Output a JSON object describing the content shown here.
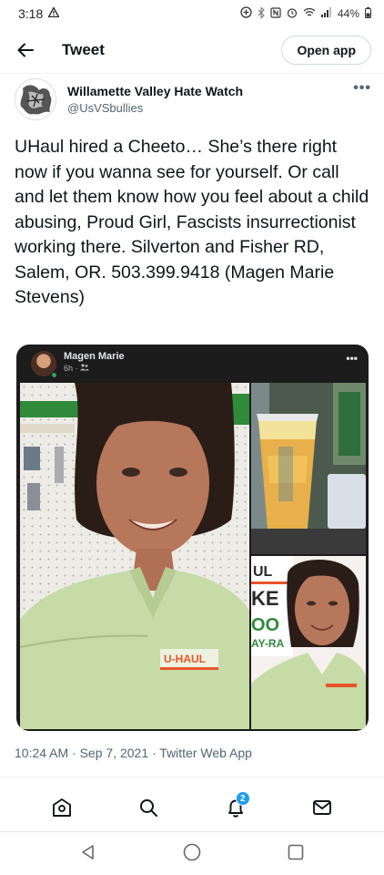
{
  "status_bar": {
    "time": "3:18",
    "battery": "44%",
    "icons": [
      "alert-icon",
      "add-circle-icon",
      "bluetooth-icon",
      "nfc-icon",
      "alarm-icon",
      "wifi-icon",
      "signal-icon",
      "battery-icon"
    ]
  },
  "header": {
    "back_icon": "back-arrow-icon",
    "title": "Tweet",
    "open_app_label": "Open app"
  },
  "tweet": {
    "author_name": "Willamette Valley Hate Watch",
    "author_handle": "@UsVSbullies",
    "more_icon": "more-icon",
    "text": "UHaul hired a Cheeto… She’s there right now if you wanna see for yourself. Or call and let them know how you feel about a child abusing, Proud Girl, Fascists insurrectionist working there. Silverton and Fisher RD, Salem, OR. 503.399.9418 (Magen Marie Stevens)",
    "timestamp": "10:24 AM · Sep 7, 2021 · Twitter Web App"
  },
  "embedded_post": {
    "name": "Magen Marie",
    "time": "6h",
    "main_photo_sign": "U-HAUL",
    "bottom_photo_sign_lines": [
      "UL",
      "KE",
      "OO",
      "AY-RA"
    ]
  },
  "tab_bar": {
    "items": [
      "home-icon",
      "search-icon",
      "notifications-icon",
      "messages-icon"
    ],
    "notification_count": "2"
  },
  "system_nav": [
    "back-triangle-icon",
    "home-circle-icon",
    "recents-square-icon"
  ],
  "colors": {
    "accent": "#1d9bf0",
    "text": "#0f1419",
    "secondary_text": "#536471",
    "media_bg": "#1c1c1c",
    "uhaul_orange": "#e8542a",
    "shirt_green": "#c6dba5"
  }
}
